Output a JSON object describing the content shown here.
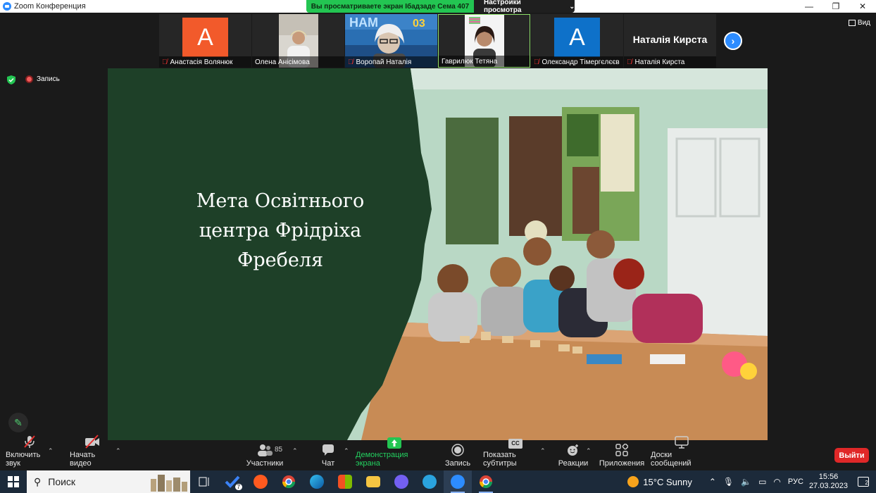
{
  "window": {
    "title": "Zoom Конференция",
    "controls": {
      "minimize": "—",
      "maximize": "❐",
      "close": "✕"
    }
  },
  "share_banner": {
    "status": "Вы просматриваете экран Ібадзаде Сема 407",
    "options": "Настройки просмотра",
    "options_icon": "chevron-down-icon"
  },
  "view_button": {
    "label": "Вид"
  },
  "recording_indicator": {
    "label": "Запись"
  },
  "participants": [
    {
      "name": "Анастасія Волянюк",
      "avatar_letter": "A",
      "avatar_color": "#f25a2b",
      "muted": true,
      "video": false
    },
    {
      "name": "Олена Анісімова",
      "muted": false,
      "video": true
    },
    {
      "name": "Воропай Наталія",
      "muted": true,
      "video": true
    },
    {
      "name": "Гаврилюк Тетяна",
      "muted": false,
      "video": true,
      "active_speaker": true
    },
    {
      "name": "Олександр Тімергєлєєв",
      "avatar_letter": "A",
      "avatar_color": "#0e71c9",
      "muted": true,
      "video": false
    },
    {
      "name": "Наталія Кирста",
      "display_name": "Наталія Кирста",
      "muted": true,
      "video": false
    }
  ],
  "slide": {
    "title_lines": [
      "Мета  Освітнього",
      "центра Фрідріха",
      "Фребеля"
    ]
  },
  "toolbar": {
    "unmute": "Включить звук",
    "start_video": "Начать видео",
    "participants": "Участники",
    "participants_count": "85",
    "chat": "Чат",
    "share_screen": "Демонстрация экрана",
    "record": "Запись",
    "captions": "Показать субтитры",
    "captions_icon_text": "CC",
    "reactions": "Реакции",
    "apps": "Приложения",
    "whiteboards": "Доски сообщений",
    "leave": "Выйти"
  },
  "taskbar": {
    "search_placeholder": "Поиск",
    "mail_badge": "7",
    "weather": "15°C  Sunny",
    "language": "РУС",
    "time": "15:56",
    "date": "27.03.2023",
    "notifications_count": "2"
  }
}
